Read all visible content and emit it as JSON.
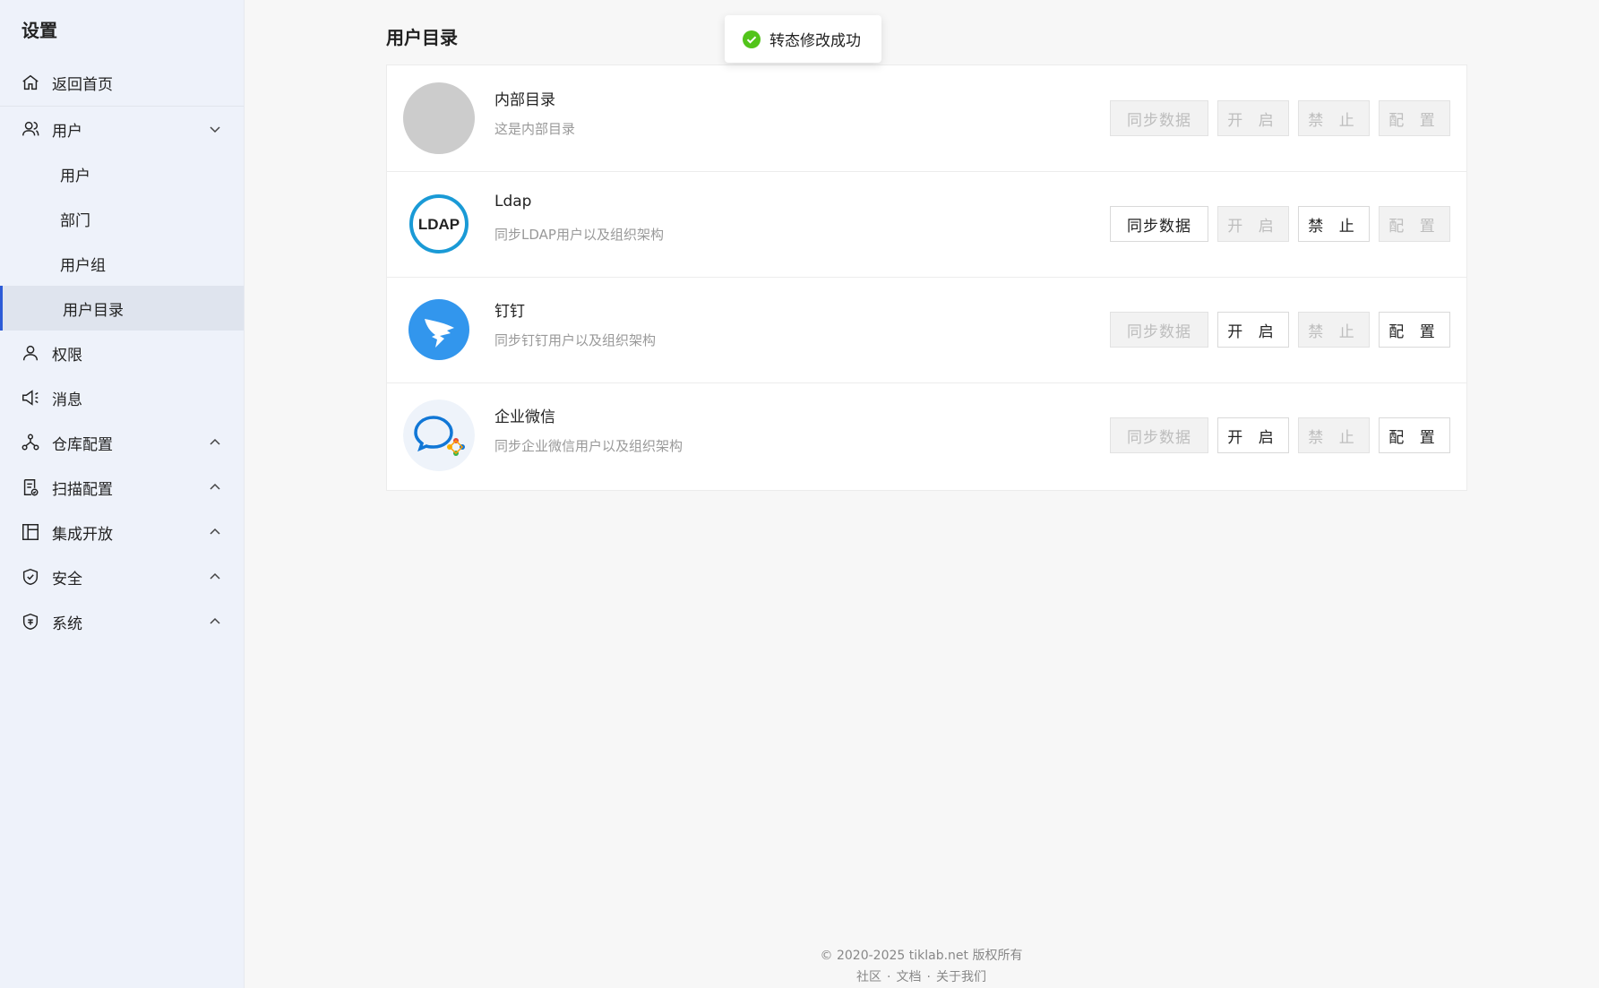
{
  "sidebar": {
    "title": "设置",
    "back_home": "返回首页",
    "user_group": {
      "label": "用户",
      "children": [
        "用户",
        "部门",
        "用户组",
        "用户目录"
      ]
    },
    "items": [
      "权限",
      "消息",
      "仓库配置",
      "扫描配置",
      "集成开放",
      "安全",
      "系统"
    ]
  },
  "main": {
    "title": "用户目录",
    "directories": [
      {
        "name": "内部目录",
        "desc": "这是内部目录",
        "logo": "gray-circle-logo"
      },
      {
        "name": "Ldap",
        "desc": "同步LDAP用户以及组织架构",
        "logo": "ldap-logo",
        "logo_text": "LDAP"
      },
      {
        "name": "钉钉",
        "desc": "同步钉钉用户以及组织架构",
        "logo": "dingtalk-logo"
      },
      {
        "name": "企业微信",
        "desc": "同步企业微信用户以及组织架构",
        "logo": "wecom-logo"
      }
    ],
    "buttons": {
      "sync": "同步数据",
      "enable": "开 启",
      "disable": "禁 止",
      "config": "配 置"
    }
  },
  "toast": {
    "message": "转态修改成功",
    "icon": "success-check-icon"
  },
  "footer": {
    "copyright": "© 2020-2025 tiklab.net 版权所有",
    "links": [
      "社区",
      "文档",
      "关于我们"
    ]
  }
}
